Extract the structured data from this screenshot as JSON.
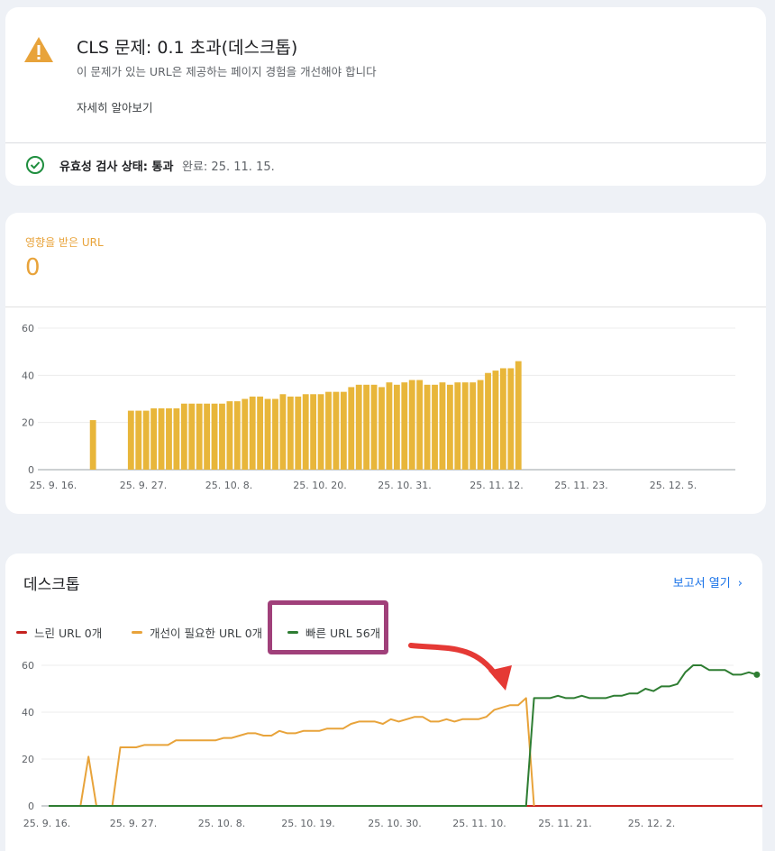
{
  "issue": {
    "title": "CLS 문제: 0.1 초과(데스크톱)",
    "subtitle": "이 문제가 있는 URL은 제공하는 페이지 경험을 개선해야 합니다",
    "learn_more": "자세히 알아보기",
    "validation_label": "유효성 검사 상태: 통과",
    "validation_done": "완료: 25. 11. 15."
  },
  "affected": {
    "label": "영향을 받은 URL",
    "count": "0"
  },
  "desktop": {
    "title": "데스크톱",
    "open_report": "보고서 열기",
    "legend": [
      {
        "label": "느린 URL 0개",
        "color": "#c5221f"
      },
      {
        "label": "개선이 필요한 URL 0개",
        "color": "#e8a33a"
      },
      {
        "label": "빠른 URL 56개",
        "color": "#2e7d32"
      }
    ]
  },
  "colors": {
    "bar": "#e8b63a",
    "poor": "#c5221f",
    "ni": "#e8a33a",
    "good": "#2e7d32",
    "highlight": "#a0407a",
    "arrow": "#e53935"
  },
  "chart_data": [
    {
      "type": "bar",
      "title": "",
      "ylim": [
        0,
        60
      ],
      "yticks": [
        0,
        20,
        40,
        60
      ],
      "xtick_labels": [
        "25. 9. 16.",
        "25. 9. 27.",
        "25. 10. 8.",
        "25. 10. 20.",
        "25. 10. 31.",
        "25. 11. 12.",
        "25. 11. 23.",
        "25. 12. 5."
      ],
      "categories": [
        "9/16",
        "9/17",
        "9/18",
        "9/19",
        "9/20",
        "9/21",
        "9/22",
        "9/23",
        "9/24",
        "9/25",
        "9/26",
        "9/27",
        "9/28",
        "9/29",
        "9/30",
        "10/1",
        "10/2",
        "10/3",
        "10/4",
        "10/5",
        "10/6",
        "10/7",
        "10/8",
        "10/9",
        "10/10",
        "10/11",
        "10/12",
        "10/13",
        "10/14",
        "10/15",
        "10/16",
        "10/17",
        "10/18",
        "10/19",
        "10/20",
        "10/21",
        "10/22",
        "10/23",
        "10/24",
        "10/25",
        "10/26",
        "10/27",
        "10/28",
        "10/29",
        "10/30",
        "10/31",
        "11/1",
        "11/2",
        "11/3",
        "11/4",
        "11/5",
        "11/6",
        "11/7",
        "11/8",
        "11/9",
        "11/10",
        "11/11",
        "11/12",
        "11/13",
        "11/14",
        "11/15",
        "11/16",
        "11/17",
        "11/18",
        "11/19",
        "11/20",
        "11/21",
        "11/22",
        "11/23",
        "11/24",
        "11/25",
        "11/26",
        "11/27",
        "11/28",
        "11/29",
        "11/30",
        "12/1",
        "12/2",
        "12/3",
        "12/4",
        "12/5",
        "12/6",
        "12/7",
        "12/8",
        "12/9",
        "12/10",
        "12/11",
        "12/12",
        "12/13",
        "12/14",
        "12/15"
      ],
      "values": [
        null,
        null,
        null,
        null,
        null,
        21,
        null,
        null,
        null,
        null,
        25,
        25,
        25,
        26,
        26,
        26,
        26,
        28,
        28,
        28,
        28,
        28,
        28,
        29,
        29,
        30,
        31,
        31,
        30,
        30,
        32,
        31,
        31,
        32,
        32,
        32,
        33,
        33,
        33,
        35,
        36,
        36,
        36,
        35,
        37,
        36,
        37,
        38,
        38,
        36,
        36,
        37,
        36,
        37,
        37,
        37,
        38,
        41,
        42,
        43,
        43,
        46
      ]
    },
    {
      "type": "line",
      "title": "",
      "ylim": [
        0,
        60
      ],
      "yticks": [
        0,
        20,
        40,
        60
      ],
      "xtick_labels": [
        "25. 9. 16.",
        "25. 9. 27.",
        "25. 10. 8.",
        "25. 10. 19.",
        "25. 10. 30.",
        "25. 11. 10.",
        "25. 11. 21.",
        "25. 12. 2."
      ],
      "x_start": "25. 9. 16.",
      "series": [
        {
          "name": "느린 URL",
          "values": [
            0,
            0,
            0,
            0,
            0,
            0,
            0,
            0,
            0,
            0,
            0,
            0,
            0,
            0,
            0,
            0,
            0,
            0,
            0,
            0,
            0,
            0,
            0,
            0,
            0,
            0,
            0,
            0,
            0,
            0,
            0,
            0,
            0,
            0,
            0,
            0,
            0,
            0,
            0,
            0,
            0,
            0,
            0,
            0,
            0,
            0,
            0,
            0,
            0,
            0,
            0,
            0,
            0,
            0,
            0,
            0,
            0,
            0,
            0,
            0,
            0,
            0,
            0,
            0,
            0,
            0,
            0,
            0,
            0,
            0,
            0,
            0,
            0,
            0,
            0,
            0,
            0,
            0,
            0,
            0,
            0,
            0,
            0,
            0,
            0,
            0,
            0,
            0,
            0,
            0,
            0
          ]
        },
        {
          "name": "개선이 필요한 URL",
          "values": [
            0,
            0,
            0,
            0,
            0,
            21,
            0,
            0,
            0,
            25,
            25,
            25,
            26,
            26,
            26,
            26,
            28,
            28,
            28,
            28,
            28,
            28,
            29,
            29,
            30,
            31,
            31,
            30,
            30,
            32,
            31,
            31,
            32,
            32,
            32,
            33,
            33,
            33,
            35,
            36,
            36,
            36,
            35,
            37,
            36,
            37,
            38,
            38,
            36,
            36,
            37,
            36,
            37,
            37,
            37,
            38,
            41,
            42,
            43,
            43,
            46,
            0
          ]
        },
        {
          "name": "빠른 URL",
          "values": [
            0,
            0,
            0,
            0,
            0,
            0,
            0,
            0,
            0,
            0,
            0,
            0,
            0,
            0,
            0,
            0,
            0,
            0,
            0,
            0,
            0,
            0,
            0,
            0,
            0,
            0,
            0,
            0,
            0,
            0,
            0,
            0,
            0,
            0,
            0,
            0,
            0,
            0,
            0,
            0,
            0,
            0,
            0,
            0,
            0,
            0,
            0,
            0,
            0,
            0,
            0,
            0,
            0,
            0,
            0,
            0,
            0,
            0,
            0,
            0,
            0,
            46,
            46,
            46,
            47,
            46,
            46,
            47,
            46,
            46,
            46,
            47,
            47,
            48,
            48,
            50,
            49,
            51,
            51,
            52,
            57,
            60,
            60,
            58,
            58,
            58,
            56,
            56,
            57,
            56
          ]
        }
      ]
    }
  ]
}
